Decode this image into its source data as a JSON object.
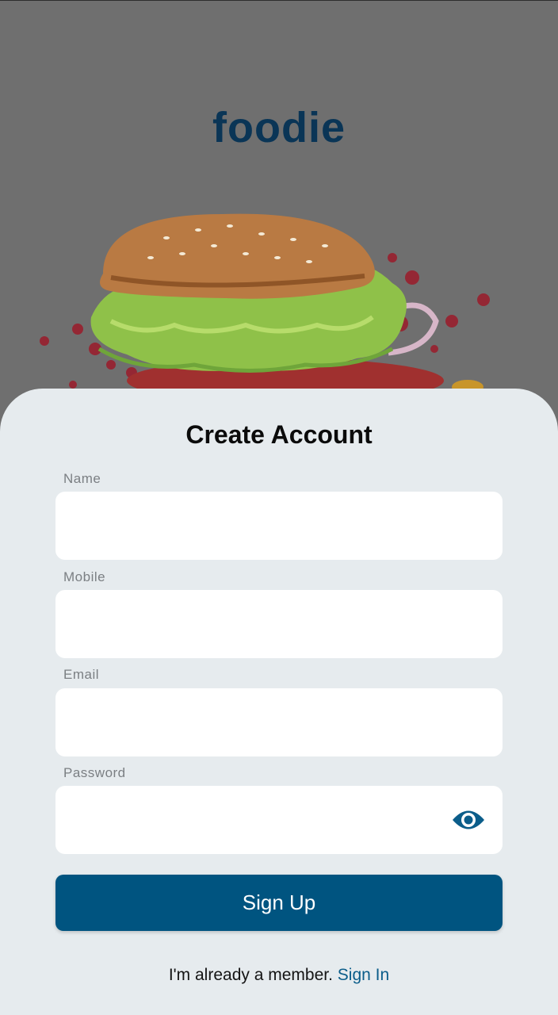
{
  "app": {
    "brand": "foodie",
    "accent_color": "#005480",
    "brand_color": "#0a3556"
  },
  "form": {
    "title": "Create Account",
    "fields": [
      {
        "label": "Name",
        "value": "",
        "placeholder": ""
      },
      {
        "label": "Mobile",
        "value": "",
        "placeholder": ""
      },
      {
        "label": "Email",
        "value": "",
        "placeholder": ""
      },
      {
        "label": "Password",
        "value": "",
        "placeholder": "",
        "icon": "eye-icon"
      }
    ],
    "submit_label": "Sign Up"
  },
  "footer": {
    "prompt": "I'm already a member.",
    "link_label": "Sign In"
  },
  "hero": {
    "image": "burger-illustration"
  }
}
